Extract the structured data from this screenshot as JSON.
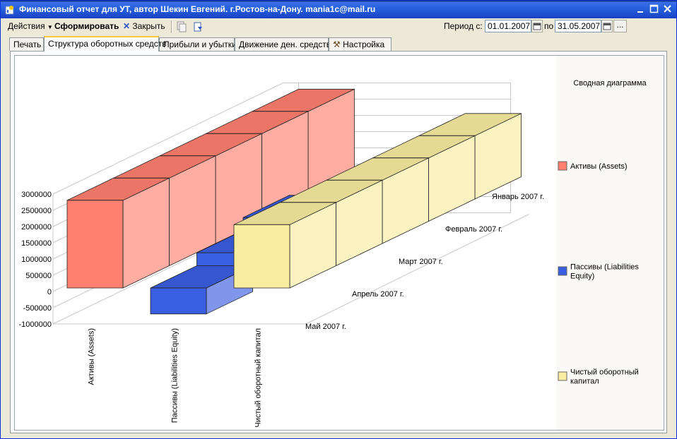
{
  "window": {
    "title": "Финансовый отчет для УТ, автор Шекин Евгений. г.Ростов-на-Дону. mania1c@mail.ru"
  },
  "toolbar": {
    "actions_label": "Действия",
    "generate_label": "Сформировать",
    "close_label": "Закрыть",
    "period_label": "Период с:",
    "date_from": "01.01.2007",
    "to_label": "по",
    "date_to": "31.05.2007",
    "more_label": "..."
  },
  "tabs": [
    {
      "label": "Печать"
    },
    {
      "label": "Структура оборотных средств"
    },
    {
      "label": "Прибыли и убытки"
    },
    {
      "label": "Движение ден. средств"
    },
    {
      "label": "Настройка"
    }
  ],
  "chart_data": {
    "type": "bar",
    "legend_title": "Сводная диаграмма",
    "y_ticks": [
      "3000000",
      "2500000",
      "2000000",
      "1500000",
      "1000000",
      "500000",
      "0",
      "-500000",
      "-1000000"
    ],
    "ylim": [
      -1000000,
      3000000
    ],
    "categories": [
      "Активы (Assets)",
      "Пассивы (Liabilities Equity)",
      "Чистый оборотный капитал"
    ],
    "months": [
      "Май 2007 г.",
      "Апрель 2007 г.",
      "Март 2007 г.",
      "Февраль 2007 г.",
      "Январь 2007 г."
    ],
    "series": [
      {
        "name": "Активы (Assets)",
        "color": "#ff8070",
        "values": [
          2700000,
          2700000,
          2700000,
          2700000,
          2700000
        ]
      },
      {
        "name": "Пассивы (Liabilities Equity)",
        "color": "#3a5ee0",
        "values": [
          -800000,
          400000,
          800000,
          400000,
          0
        ]
      },
      {
        "name": "Чистый оборотный капитал",
        "color": "#f8eda0",
        "values": [
          1950000,
          1950000,
          1950000,
          1950000,
          1950000
        ]
      }
    ],
    "legend": [
      {
        "label": "Активы (Assets)",
        "color": "#ff8070"
      },
      {
        "label": "Пассивы (Liabilities Equity)",
        "color": "#3a5ee0"
      },
      {
        "label": "Чистый оборотный капитал",
        "color": "#f8eda0"
      }
    ]
  }
}
